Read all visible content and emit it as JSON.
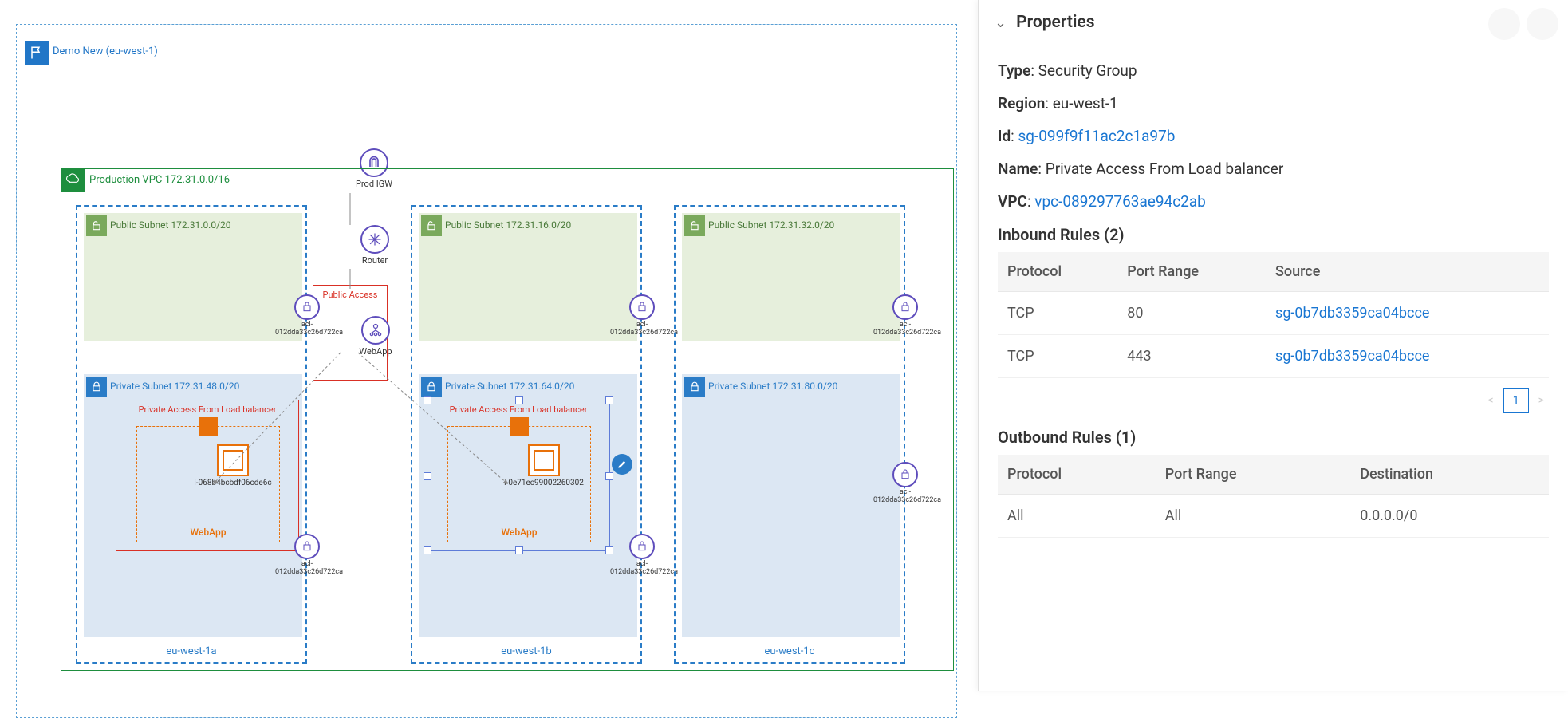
{
  "region": {
    "label": "Demo New (eu-west-1)",
    "code": "eu-west-1"
  },
  "vpc": {
    "label": "Production VPC 172.31.0.0/16",
    "cidr": "172.31.0.0/16"
  },
  "igw": {
    "label": "Prod IGW"
  },
  "router": {
    "label": "Router"
  },
  "loadbalancer": {
    "label": "WebApp"
  },
  "sg_public": {
    "label": "Public Access"
  },
  "azs": [
    {
      "code": "eu-west-1a"
    },
    {
      "code": "eu-west-1b"
    },
    {
      "code": "eu-west-1c"
    }
  ],
  "subnets": {
    "public": [
      {
        "label": "Public Subnet 172.31.0.0/20"
      },
      {
        "label": "Public Subnet 172.31.16.0/20"
      },
      {
        "label": "Public Subnet 172.31.32.0/20"
      }
    ],
    "private": [
      {
        "label": "Private Subnet 172.31.48.0/20"
      },
      {
        "label": "Private Subnet 172.31.64.0/20"
      },
      {
        "label": "Private Subnet 172.31.80.0/20"
      }
    ]
  },
  "acl": {
    "label": "acl-012dda33c26d722ca"
  },
  "sg_private": {
    "label": "Private Access From Load balancer"
  },
  "asg": {
    "label": "WebApp"
  },
  "instances": [
    {
      "id": "i-068b4bcbdf06cde6c"
    },
    {
      "id": "i-0e71ec99002260302"
    }
  ],
  "properties": {
    "title": "Properties",
    "type_label": "Type",
    "type_value": "Security Group",
    "region_label": "Region",
    "region_value": "eu-west-1",
    "id_label": "Id",
    "id_value": "sg-099f9f11ac2c1a97b",
    "name_label": "Name",
    "name_value": "Private Access From Load balancer",
    "vpc_label": "VPC",
    "vpc_value": "vpc-089297763ae94c2ab",
    "colon": ": "
  },
  "inbound": {
    "title": "Inbound Rules (2)",
    "headers": {
      "protocol": "Protocol",
      "port": "Port Range",
      "source": "Source"
    },
    "rows": [
      {
        "protocol": "TCP",
        "port": "80",
        "source": "sg-0b7db3359ca04bcce"
      },
      {
        "protocol": "TCP",
        "port": "443",
        "source": "sg-0b7db3359ca04bcce"
      }
    ],
    "page": "1"
  },
  "outbound": {
    "title": "Outbound Rules (1)",
    "headers": {
      "protocol": "Protocol",
      "port": "Port Range",
      "destination": "Destination"
    },
    "rows": [
      {
        "protocol": "All",
        "port": "All",
        "destination": "0.0.0.0/0"
      }
    ]
  }
}
